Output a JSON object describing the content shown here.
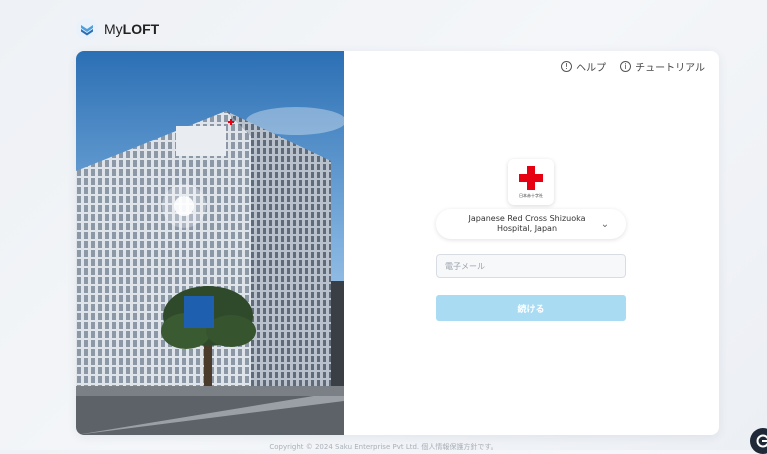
{
  "brand": {
    "name_prefix": "My",
    "name_bold": "LOFT"
  },
  "header_links": {
    "help": "ヘルプ",
    "tutorial": "チュートリアル"
  },
  "organization": {
    "name": "Japanese Red Cross Shizuoka Hospital, Japan",
    "logo_caption": "日本赤十字社"
  },
  "email_field": {
    "placeholder": "電子メール",
    "value": ""
  },
  "continue_button": {
    "label": "続ける"
  },
  "footer": {
    "text": "Copyright © 2024 Saku Enterprise Pvt Ltd. 個人情報保護方針です。"
  },
  "colors": {
    "accent": "#a9dbf3",
    "logo_red": "#e60012"
  }
}
